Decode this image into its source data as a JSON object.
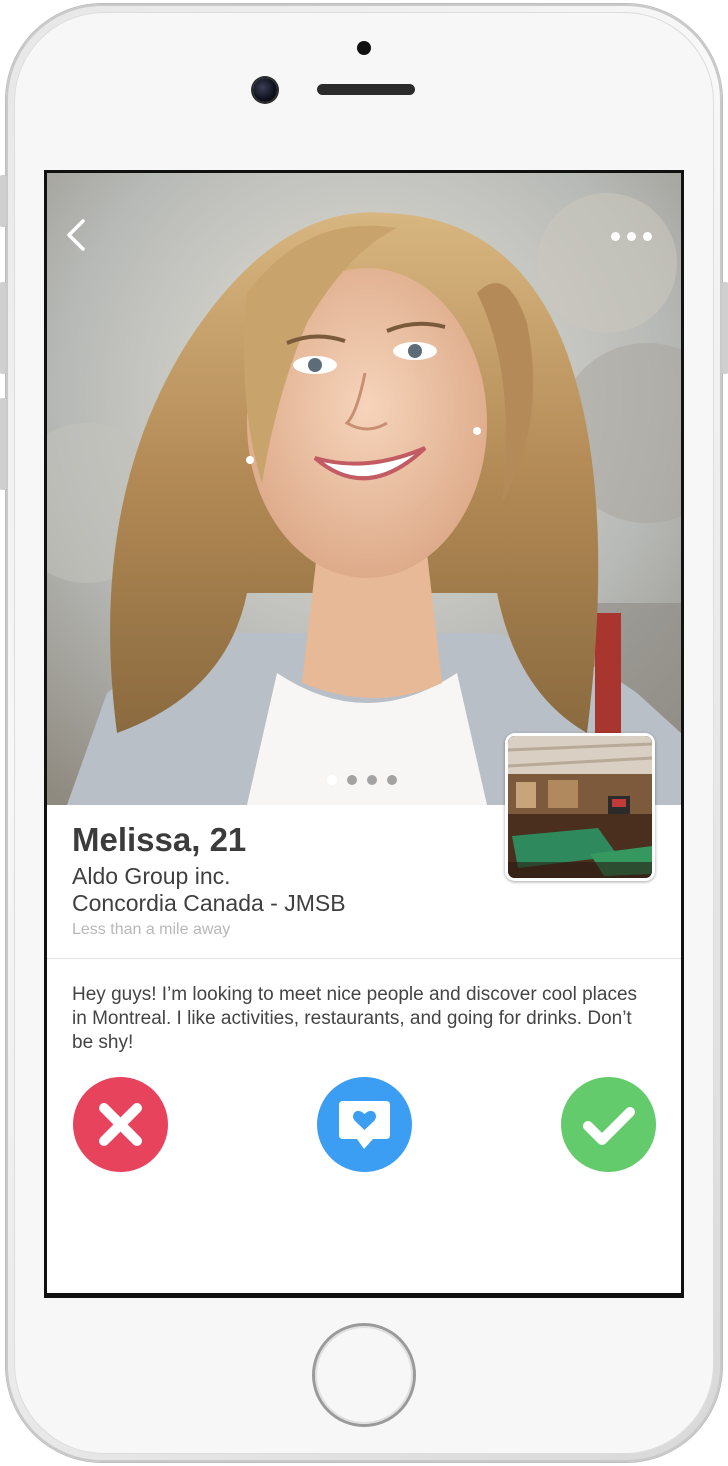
{
  "device": {
    "frame_color": "#f7f7f7"
  },
  "profile": {
    "name_age": "Melissa, 21",
    "company": "Aldo Group inc.",
    "school": "Concordia Canada - JMSB",
    "distance": "Less than a mile away",
    "bio": "Hey guys! I’m looking to meet nice people and discover cool places in Montreal. I like activities, restaurants, and going for drinks. Don’t be shy!",
    "photo_count": 4,
    "active_photo_index": 1
  },
  "nav": {
    "back_icon": "chevron-left-icon",
    "more_icon": "ellipsis-icon"
  },
  "actions": {
    "reject": {
      "icon": "close-icon",
      "color": "#e8435d"
    },
    "message": {
      "icon": "chat-heart-icon",
      "color": "#3b9ef2"
    },
    "accept": {
      "icon": "checkmark-icon",
      "color": "#63cb6b"
    }
  }
}
